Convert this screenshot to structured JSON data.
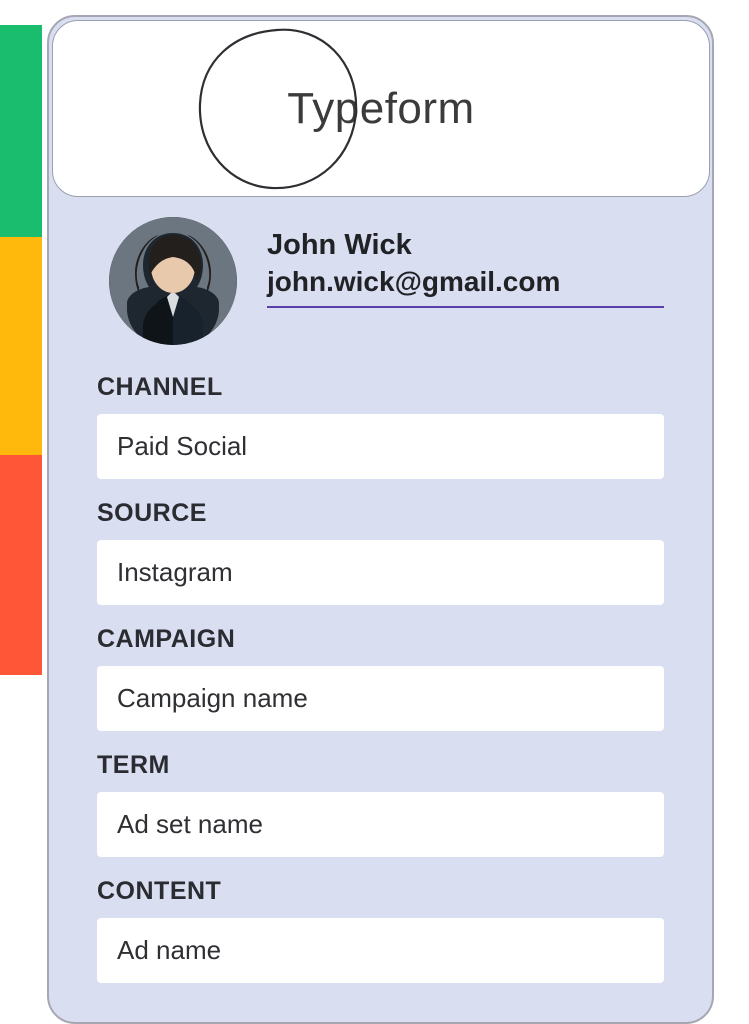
{
  "sidebar_tabs": {
    "colors": [
      "#1abc6e",
      "#ffb90d",
      "#ff5637"
    ]
  },
  "header": {
    "app_name": "Typeform"
  },
  "profile": {
    "name": "John Wick",
    "email": "john.wick@gmail.com"
  },
  "fields": {
    "channel": {
      "label": "CHANNEL",
      "value": "Paid Social"
    },
    "source": {
      "label": "SOURCE",
      "value": "Instagram"
    },
    "campaign": {
      "label": "CAMPAIGN",
      "value": "Campaign name"
    },
    "term": {
      "label": "TERM",
      "value": "Ad set name"
    },
    "content": {
      "label": "CONTENT",
      "value": "Ad name"
    }
  }
}
